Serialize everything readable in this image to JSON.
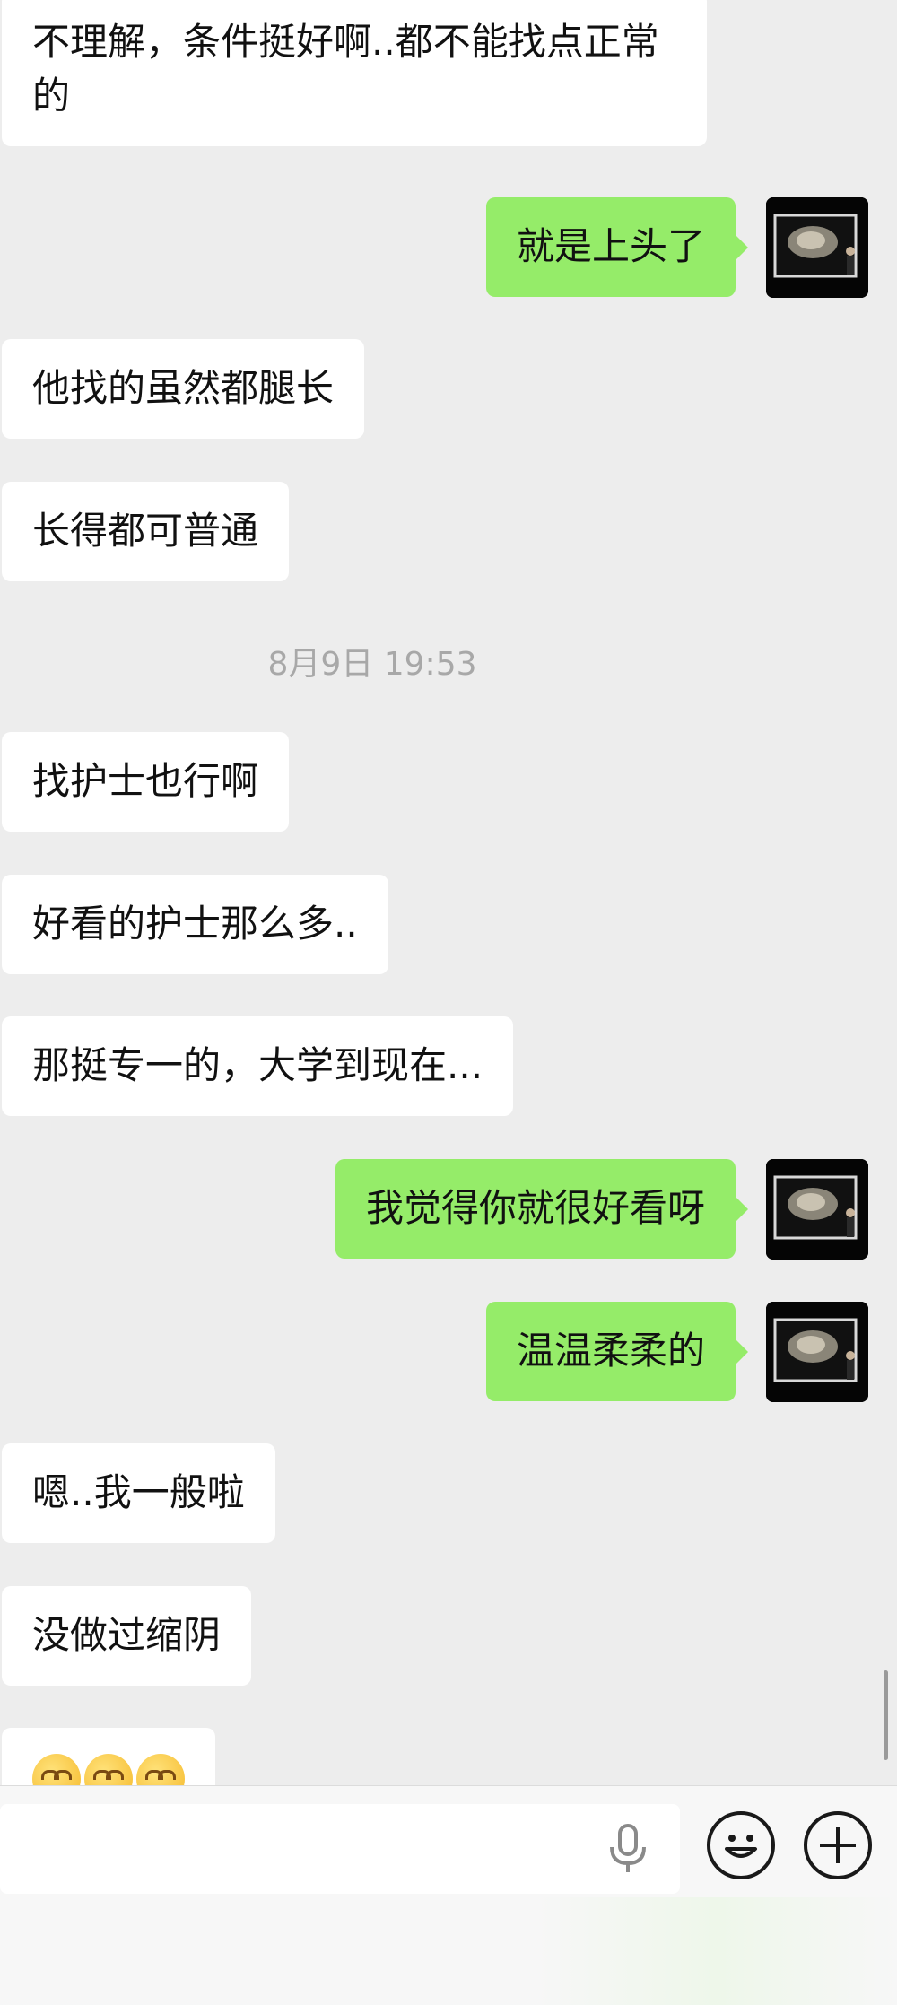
{
  "messages": [
    {
      "side": "in",
      "text": "不理解，条件挺好啊..都不能找点正常的"
    },
    {
      "side": "out",
      "text": "就是上头了"
    },
    {
      "side": "in",
      "text": "他找的虽然都腿长"
    },
    {
      "side": "in",
      "text": "长得都可普通"
    },
    {
      "side": "in",
      "text": "找护士也行啊"
    },
    {
      "side": "in",
      "text": "好看的护士那么多.."
    },
    {
      "side": "in",
      "text": "那挺专一的，大学到现在..."
    },
    {
      "side": "out",
      "text": "我觉得你就很好看呀"
    },
    {
      "side": "out",
      "text": "温温柔柔的"
    },
    {
      "side": "in",
      "text": "嗯..我一般啦"
    },
    {
      "side": "in",
      "text": "没做过缩阴"
    },
    {
      "side": "in",
      "emoji": [
        "flushed-face-emoji",
        "flushed-face-emoji",
        "flushed-face-emoji"
      ]
    }
  ],
  "timestamp": "8月9日 19:53",
  "input": {
    "value": "",
    "placeholder": ""
  },
  "icons": {
    "voice": "microphone-icon",
    "emoji": "smiley-face-icon",
    "more": "plus-icon"
  },
  "colors": {
    "background": "#ededed",
    "incoming_bubble": "#ffffff",
    "outgoing_bubble": "#95ec69",
    "timestamp_text": "#a8a8a8"
  }
}
